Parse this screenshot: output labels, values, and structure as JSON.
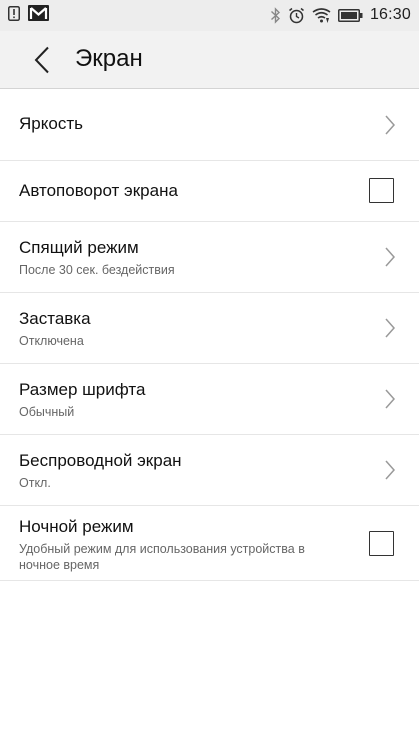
{
  "status_bar": {
    "time": "16:30",
    "left_icons": [
      "notification-alert-icon",
      "gmail-icon"
    ],
    "right_icons": [
      "bluetooth-icon",
      "alarm-icon",
      "wifi-icon",
      "battery-icon"
    ]
  },
  "app_bar": {
    "title": "Экран",
    "back_icon": "chevron-left-icon"
  },
  "settings": [
    {
      "title": "Яркость",
      "subtitle": "",
      "control": "chevron"
    },
    {
      "title": "Автоповорот экрана",
      "subtitle": "",
      "control": "checkbox",
      "checked": false
    },
    {
      "title": "Спящий режим",
      "subtitle": "После 30 сек. бездействия",
      "control": "chevron"
    },
    {
      "title": "Заставка",
      "subtitle": "Отключена",
      "control": "chevron"
    },
    {
      "title": "Размер шрифта",
      "subtitle": "Обычный",
      "control": "chevron"
    },
    {
      "title": "Беспроводной экран",
      "subtitle": "Откл.",
      "control": "chevron"
    },
    {
      "title": "Ночной режим",
      "subtitle": "Удобный режим для использования устройства в ночное время",
      "control": "checkbox",
      "checked": false
    }
  ]
}
